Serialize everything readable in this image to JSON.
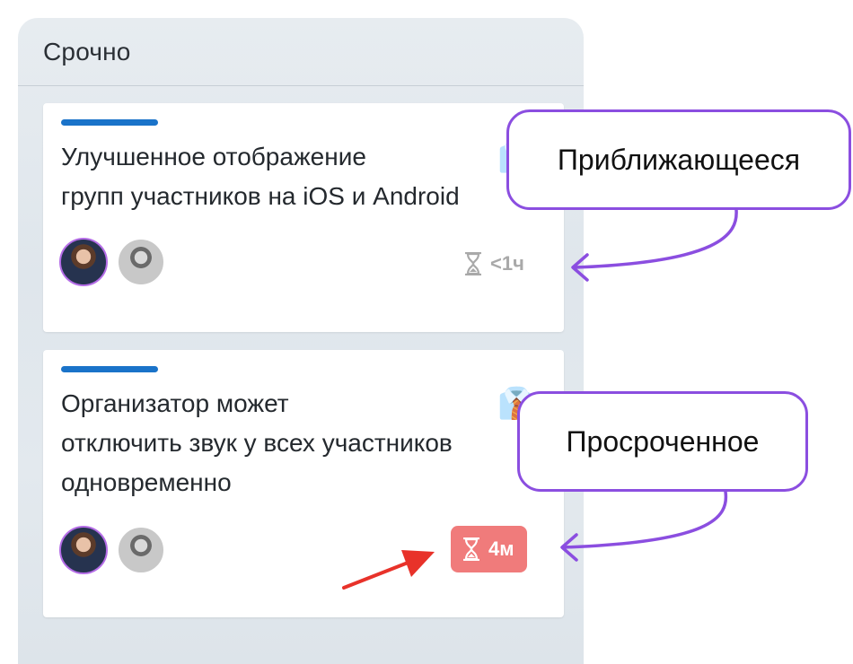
{
  "column": {
    "title": "Срочно"
  },
  "cards": [
    {
      "title": "Улучшенное отображение\nгрупп участников на iOS и Android",
      "emoji_icon": "necktie-shirt-icon",
      "emoji": "👔",
      "due_label": "<1ч",
      "due_state": "soon"
    },
    {
      "title": "Организатор может\nотключить звук у всех участников\nодновременно",
      "emoji_icon": "necktie-shirt-icon",
      "emoji": "👔",
      "due_label": "4м",
      "due_state": "overdue"
    }
  ],
  "callouts": {
    "soon": "Приближающееся",
    "overdue": "Просроченное"
  },
  "colors": {
    "accent": "#1a73c9",
    "callout_border": "#8b4ee0",
    "overdue_bg": "#f07b7b",
    "soon_text": "#a9a9a9",
    "arrow_red": "#e8322a"
  }
}
